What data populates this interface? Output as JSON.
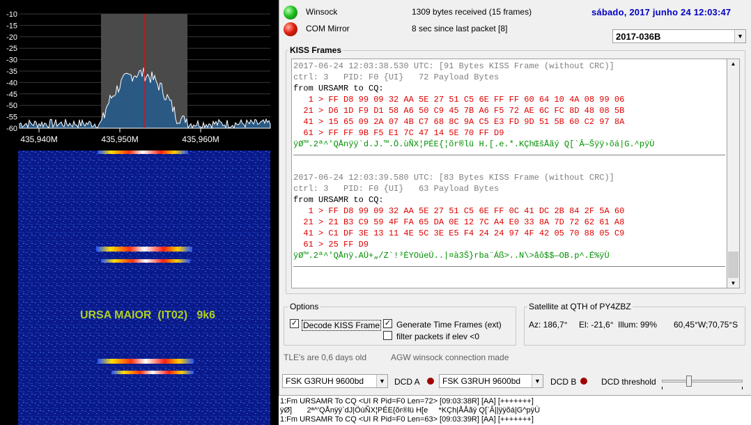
{
  "spectrum": {
    "y_ticks": [
      "-10",
      "-15",
      "-20",
      "-25",
      "-30",
      "-35",
      "-40",
      "-45",
      "-50",
      "-55",
      "-60"
    ],
    "x_ticks": [
      "435,940M",
      "435,950M",
      "435,960M"
    ],
    "colors": {
      "trace": "#ffffff",
      "fill": "#2a5a84",
      "passband": "#4a4a4a",
      "center_line": "#ff0000"
    }
  },
  "waterfall": {
    "label": "URSA MAIOR  (IT02)   9k6",
    "label_color": "#b0d020"
  },
  "status": {
    "winsock_label": "Winsock",
    "winsock_led": "green",
    "bytes_received": "1309 bytes received (15 frames)",
    "commirror_label": "COM Mirror",
    "commirror_led": "red",
    "since_last": "8 sec since last packet [8]",
    "datetime": "sábado, 2017 junho 24  12:03:47",
    "datetime_color": "#0000c0"
  },
  "satellite_select": {
    "value": "2017-036B"
  },
  "kiss": {
    "title": "KISS Frames",
    "frames": [
      {
        "header": "2017-06-24 12:03:38.530 UTC: [91 Bytes KISS Frame (without CRC)]",
        "ctrl": "ctrl: 3   PID: F0 {UI}   72 Payload Bytes",
        "from": "from URSAMR to CQ:",
        "hex": [
          "   1 > FF D8 99 09 32 AA 5E 27 51 C5 6E FF FF 60 64 10 4A 08 99 06",
          "  21 > D6 1D F9 D1 58 A6 50 C9 45 7B A6 F5 72 AE 6C FC 8D 48 08 5B",
          "  41 > 15 65 09 2A 07 4B C7 68 8C 9A C5 E3 FD 9D 51 5B 60 C2 97 8A",
          "  61 > FF FF 9B F5 E1 7C 47 14 5E 70 FF D9"
        ],
        "ascii": "ÿØ™.2ª^'QÅnÿÿ`d.J.™.Ö.ùÑX¦PÉE{¦õr®lü H.[.e.*.KÇhŒšÅãý Q[`Â—Šÿÿ›õá|G.^pÿÙ"
      },
      {
        "header": "2017-06-24 12:03:39.580 UTC: [83 Bytes KISS Frame (without CRC)]",
        "ctrl": "ctrl: 3   PID: F0 {UI}   63 Payload Bytes",
        "from": "from URSAMR to CQ:",
        "hex": [
          "   1 > FF D8 99 09 32 AA 5E 27 51 C5 6E FF 0C 41 DC 2B 84 2F 5A 60",
          "  21 > 21 B3 C9 59 4F FA 65 DA 0E 12 7C A4 E0 33 8A 7D 72 62 61 A8",
          "  41 > C1 DF 3E 13 11 4E 5C 3E E5 F4 24 24 97 4F 42 05 70 88 05 C9",
          "  61 > 25 FF D9"
        ],
        "ascii": "ÿØ™.2ª^'QÅnÿ.AÜ+„/Z`!³ÉYOúeÚ..|¤à3Š}rba¨Áß>..N\\>åô$$—OB.p^.É%ÿÙ"
      }
    ]
  },
  "options": {
    "title": "Options",
    "decode_kiss": {
      "label": "Decode KISS Frame",
      "checked": true
    },
    "generate_time": {
      "label": "Generate Time Frames (ext)",
      "checked": true
    },
    "filter_packets": {
      "label": "filter packets if elev <0",
      "checked": false
    }
  },
  "satellite_qth": {
    "title": "Satellite at QTH of PY4ZBZ",
    "az": "Az: 186,7°",
    "el": "El: -21,6°",
    "illum": "Illum: 99%",
    "position": "60,45°W;70,75°S"
  },
  "footer": {
    "tle_age": "TLE's are 0,6 days old",
    "agw_status": "AGW winsock connection made"
  },
  "decoders": {
    "dcd_a_select": "FSK G3RUH 9600bd",
    "dcd_a_label": "DCD A",
    "dcd_b_select": "FSK G3RUH 9600bd",
    "dcd_b_label": "DCD B",
    "threshold_label": "DCD threshold"
  },
  "log": [
    "1:Fm URSAMR To CQ <UI R Pid=F0 Len=72> [09:03:38R] [AA] [+++++++]",
    "ÿØ]       2ª^'QÅnÿÿ`dJ|ÖùÑX¦PÉE{õr®lü H[e     *KÇh|ÅÅãý Q[`Â||ÿÿõá|G^pÿÙ",
    "1:Fm URSAMR To CQ <UI R Pid=F0 Len=63> [09:03:39R] [AA] [+++++++]"
  ]
}
